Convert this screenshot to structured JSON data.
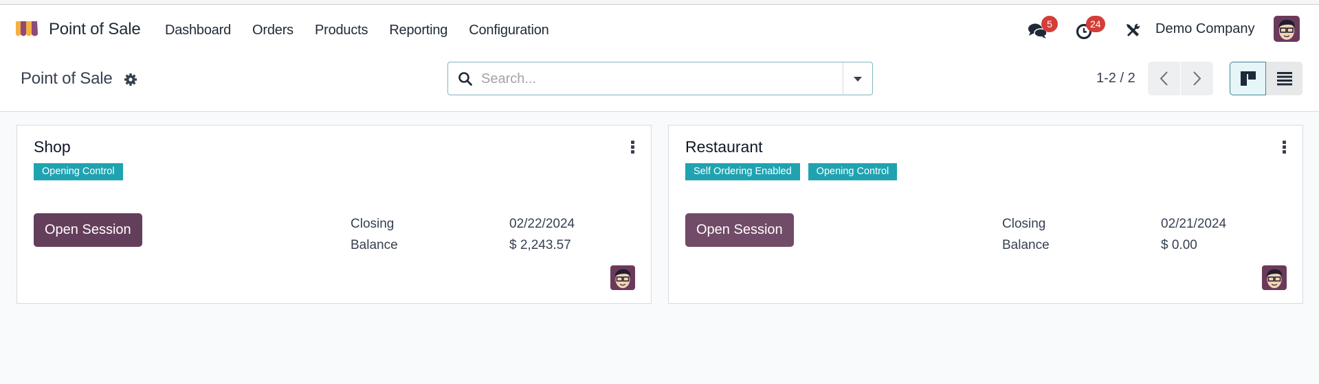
{
  "navbar": {
    "app_name": "Point of Sale",
    "menu": [
      "Dashboard",
      "Orders",
      "Products",
      "Reporting",
      "Configuration"
    ],
    "messages_count": "5",
    "activities_count": "24",
    "company": "Demo Company",
    "icons": {
      "app": "pos-awning-logo",
      "messages": "chat-bubbles-icon",
      "activities": "clock-icon",
      "tools": "wrench-screwdriver-icon",
      "user": "user-avatar"
    }
  },
  "control_panel": {
    "breadcrumb": "Point of Sale",
    "search": {
      "placeholder": "Search...",
      "value": ""
    },
    "pager": "1-2 / 2",
    "active_view": "kanban"
  },
  "colors": {
    "primary": "#714b67",
    "tag": "#1fa3b1",
    "badge": "#d23f3a"
  },
  "cards": [
    {
      "title": "Shop",
      "tags": [
        "Opening Control"
      ],
      "button": "Open Session",
      "closing_label": "Closing",
      "closing_value": "02/22/2024",
      "balance_label": "Balance",
      "balance_value": "$ 2,243.57"
    },
    {
      "title": "Restaurant",
      "tags": [
        "Self Ordering Enabled",
        "Opening Control"
      ],
      "button": "Open Session",
      "closing_label": "Closing",
      "closing_value": "02/21/2024",
      "balance_label": "Balance",
      "balance_value": "$ 0.00"
    }
  ]
}
